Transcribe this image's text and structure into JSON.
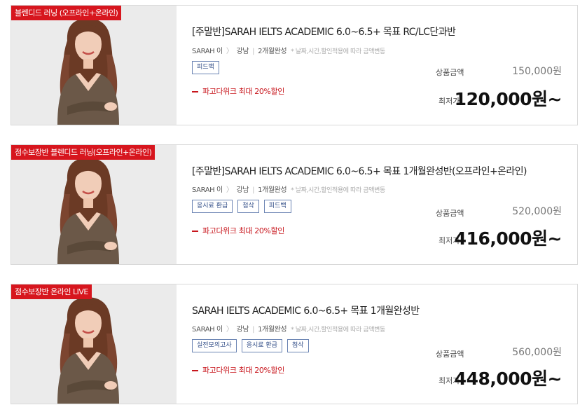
{
  "colors": {
    "badge": "#d7161e",
    "promo": "#c8161d",
    "tag_border": "#6b84b3"
  },
  "products": [
    {
      "badge": "블렌디드 러닝 (오프라인+온라인)",
      "title": "[주말반]SARAH IELTS ACADEMIC 6.0~6.5+ 목표 RC/LC단과반",
      "teacher": "SARAH 이",
      "location": "강남",
      "duration": "2개월완성",
      "note": "* 날짜,시간,할인적용에 따라 금액변동",
      "tags": [
        "피드백"
      ],
      "promo": "파고다위크 최대 20%할인",
      "price_label": "상품금액",
      "price": "150,000원",
      "final_label": "최저가",
      "final_price": "120,000원~"
    },
    {
      "badge": "점수보장반 블렌디드 러닝(오프라인+온라인)",
      "title": "[주말반]SARAH IELTS ACADEMIC 6.0~6.5+ 목표 1개월완성반(오프라인+온라인)",
      "teacher": "SARAH 이",
      "location": "강남",
      "duration": "1개월완성",
      "note": "* 날짜,시간,할인적용에 따라 금액변동",
      "tags": [
        "응시료 환급",
        "첨삭",
        "피드백"
      ],
      "promo": "파고다위크 최대 20%할인",
      "price_label": "상품금액",
      "price": "520,000원",
      "final_label": "최저가",
      "final_price": "416,000원~"
    },
    {
      "badge": "점수보장반 온라인 LIVE",
      "title": "SARAH IELTS ACADEMIC 6.0~6.5+ 목표 1개월완성반",
      "teacher": "SARAH 이",
      "location": "강남",
      "duration": "1개월완성",
      "note": "* 날짜,시간,할인적용에 따라 금액변동",
      "tags": [
        "실전모의고사",
        "응시료 환급",
        "첨삭"
      ],
      "promo": "파고다위크 최대 20%할인",
      "price_label": "상품금액",
      "price": "560,000원",
      "final_label": "최저가",
      "final_price": "448,000원~"
    }
  ]
}
